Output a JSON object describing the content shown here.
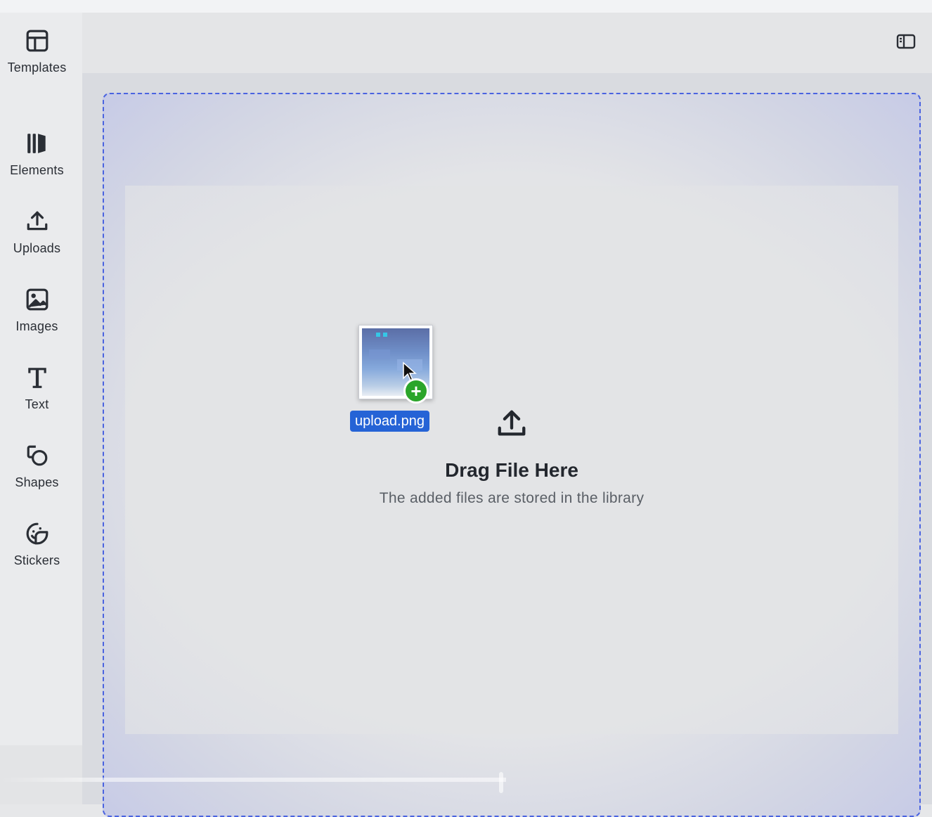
{
  "sidebar": {
    "items": [
      {
        "label": "Templates",
        "icon": "templates-icon"
      },
      {
        "label": "Elements",
        "icon": "elements-icon"
      },
      {
        "label": "Uploads",
        "icon": "upload-icon"
      },
      {
        "label": "Images",
        "icon": "image-icon"
      },
      {
        "label": "Text",
        "icon": "text-icon"
      },
      {
        "label": "Shapes",
        "icon": "shapes-icon"
      },
      {
        "label": "Stickers",
        "icon": "sticker-icon"
      }
    ]
  },
  "header": {
    "panel_toggle_icon": "sidebar-panel-icon"
  },
  "dropzone": {
    "icon": "upload-icon",
    "title": "Drag File Here",
    "subtitle": "The added files are stored in the library"
  },
  "drag_file": {
    "name": "upload.png",
    "badge_symbol": "+",
    "badge_color": "#2aa52a",
    "label_color": "#2563d6"
  },
  "colors": {
    "dropzone_border": "#4a63e0",
    "background": "#e6e7e9"
  }
}
